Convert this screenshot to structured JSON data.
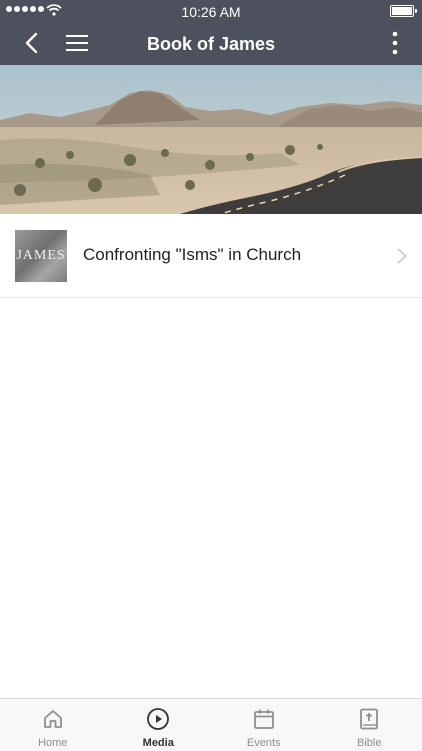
{
  "status_bar": {
    "time": "10:26 AM"
  },
  "header": {
    "title": "Book of James"
  },
  "list": [
    {
      "thumb_text": "JAMES",
      "title": "Confronting \"Isms\" in Church"
    }
  ],
  "tabs": [
    {
      "label": "Home",
      "icon": "home-icon"
    },
    {
      "label": "Media",
      "icon": "play-circle-icon"
    },
    {
      "label": "Events",
      "icon": "calendar-icon"
    },
    {
      "label": "Bible",
      "icon": "bible-icon"
    }
  ],
  "colors": {
    "header_bg": "#4d505d",
    "tab_active": "#333333",
    "tab_inactive": "#8e8e93"
  }
}
